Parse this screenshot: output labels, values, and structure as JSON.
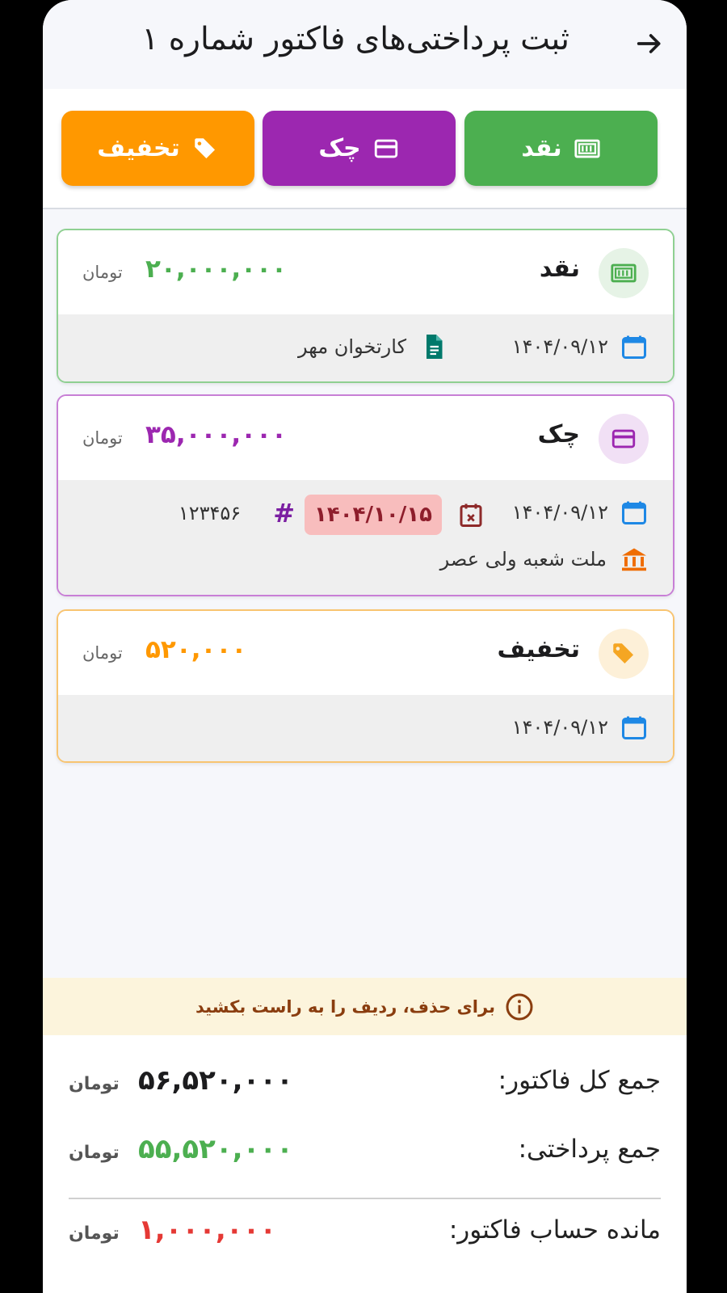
{
  "header": {
    "title": "ثبت پرداختی‌های فاکتور شماره ۱",
    "back_icon": "arrow-back-icon"
  },
  "toolbar": {
    "cash_label": "نقد",
    "check_label": "چک",
    "discount_label": "تخفیف"
  },
  "colors": {
    "cash": "#4caf50",
    "check": "#9c27b0",
    "discount": "#ff9800",
    "remaining": "#e53935"
  },
  "payments": [
    {
      "type": "نقد",
      "amount": "۲۰,۰۰۰,۰۰۰",
      "unit": "تومان",
      "date": "۱۴۰۴/۰۹/۱۲",
      "note": "کارتخوان مهر"
    },
    {
      "type": "چک",
      "amount": "۳۵,۰۰۰,۰۰۰",
      "unit": "تومان",
      "date": "۱۴۰۴/۰۹/۱۲",
      "due_date": "۱۴۰۴/۱۰/۱۵",
      "check_number": "۱۲۳۴۵۶",
      "bank": "ملت شعبه ولی عصر"
    },
    {
      "type": "تخفیف",
      "amount": "۵۲۰,۰۰۰",
      "unit": "تومان",
      "date": "۱۴۰۴/۰۹/۱۲"
    }
  ],
  "hint": "برای حذف، ردیف را به راست بکشید",
  "summary": {
    "total_label": "جمع کل فاکتور:",
    "total_value": "۵۶,۵۲۰,۰۰۰",
    "paid_label": "جمع پرداختی:",
    "paid_value": "۵۵,۵۲۰,۰۰۰",
    "remaining_label": "مانده حساب فاکتور:",
    "remaining_value": "۱,۰۰۰,۰۰۰",
    "unit": "تومان"
  }
}
